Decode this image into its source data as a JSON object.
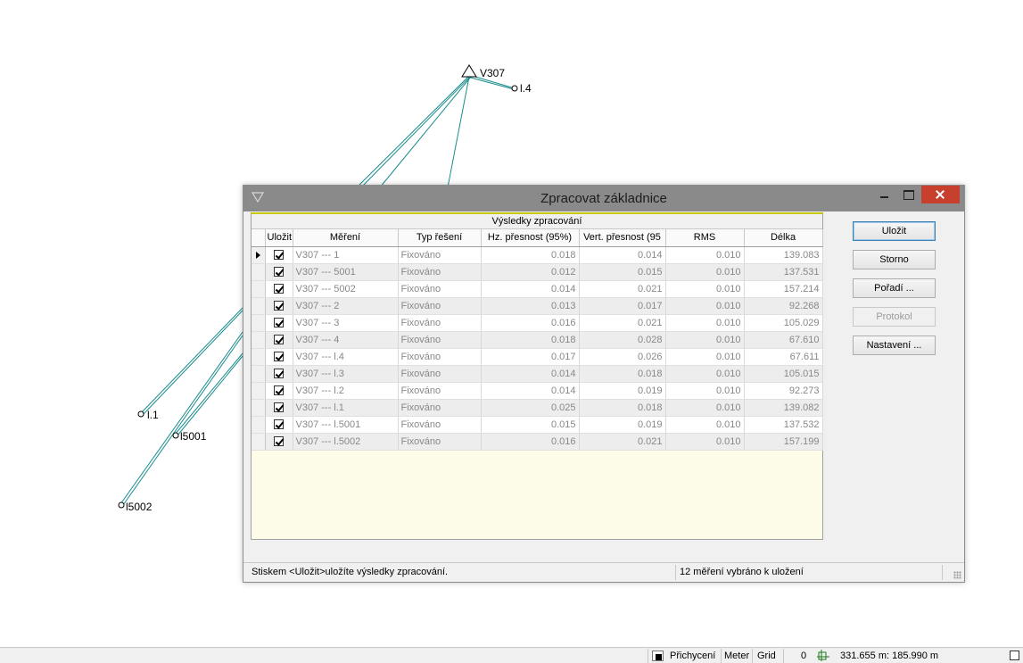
{
  "drawing": {
    "station_label": "V307",
    "point_labels": {
      "p_l4": "l.4",
      "p_l1": "l.1",
      "p_5001": "l5001",
      "p_5002": "l5002"
    },
    "line_color": "#1a8c8c"
  },
  "dialog": {
    "title": "Zpracovat základnice",
    "grid_caption": "Výsledky zpracování",
    "columns": [
      "Uložit",
      "Měření",
      "Typ řešení",
      "Hz. přesnost (95%)",
      "Vert. přesnost (95",
      "RMS",
      "Délka"
    ],
    "rows": [
      {
        "save": true,
        "measurement": "V307 --- 1",
        "solution": "Fixováno",
        "hz": "0.018",
        "vert": "0.014",
        "rms": "0.010",
        "length": "139.083",
        "selected": true
      },
      {
        "save": true,
        "measurement": "V307 --- 5001",
        "solution": "Fixováno",
        "hz": "0.012",
        "vert": "0.015",
        "rms": "0.010",
        "length": "137.531"
      },
      {
        "save": true,
        "measurement": "V307 --- 5002",
        "solution": "Fixováno",
        "hz": "0.014",
        "vert": "0.021",
        "rms": "0.010",
        "length": "157.214"
      },
      {
        "save": true,
        "measurement": "V307 --- 2",
        "solution": "Fixováno",
        "hz": "0.013",
        "vert": "0.017",
        "rms": "0.010",
        "length": "92.268"
      },
      {
        "save": true,
        "measurement": "V307 --- 3",
        "solution": "Fixováno",
        "hz": "0.016",
        "vert": "0.021",
        "rms": "0.010",
        "length": "105.029"
      },
      {
        "save": true,
        "measurement": "V307 --- 4",
        "solution": "Fixováno",
        "hz": "0.018",
        "vert": "0.028",
        "rms": "0.010",
        "length": "67.610"
      },
      {
        "save": true,
        "measurement": "V307 --- l.4",
        "solution": "Fixováno",
        "hz": "0.017",
        "vert": "0.026",
        "rms": "0.010",
        "length": "67.611"
      },
      {
        "save": true,
        "measurement": "V307 --- l.3",
        "solution": "Fixováno",
        "hz": "0.014",
        "vert": "0.018",
        "rms": "0.010",
        "length": "105.015"
      },
      {
        "save": true,
        "measurement": "V307 --- l.2",
        "solution": "Fixováno",
        "hz": "0.014",
        "vert": "0.019",
        "rms": "0.010",
        "length": "92.273"
      },
      {
        "save": true,
        "measurement": "V307 --- l.1",
        "solution": "Fixováno",
        "hz": "0.025",
        "vert": "0.018",
        "rms": "0.010",
        "length": "139.082"
      },
      {
        "save": true,
        "measurement": "V307 --- l.5001",
        "solution": "Fixováno",
        "hz": "0.015",
        "vert": "0.019",
        "rms": "0.010",
        "length": "137.532"
      },
      {
        "save": true,
        "measurement": "V307 --- l.5002",
        "solution": "Fixováno",
        "hz": "0.016",
        "vert": "0.021",
        "rms": "0.010",
        "length": "157.199"
      }
    ],
    "buttons": {
      "save": "Uložit",
      "cancel": "Storno",
      "order": "Pořadí ...",
      "protocol": "Protokol",
      "settings": "Nastavení ..."
    },
    "status_hint": "Stiskem <Uložit>uložíte výsledky zpracování.",
    "status_count": "12 měření vybráno k uložení"
  },
  "app_status": {
    "snap": "Přichycení",
    "units": "Meter",
    "grid": "Grid",
    "zero": "0",
    "coords": "331.655 m: 185.990 m"
  },
  "colors": {
    "titlebar": "#8a8a8a",
    "close_button": "#c7402e",
    "grid_background": "#fcfce9"
  }
}
